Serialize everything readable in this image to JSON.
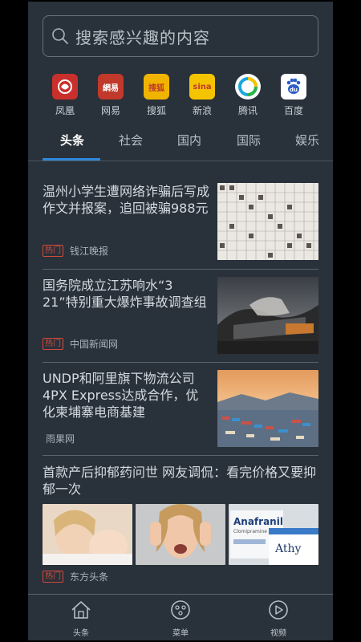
{
  "search": {
    "placeholder": "搜索感兴趣的内容"
  },
  "sources": [
    {
      "name": "凤凰",
      "icon": "ifeng-logo",
      "color": "#c9302c"
    },
    {
      "name": "网易",
      "icon": "netease-logo",
      "color": "#c0392b"
    },
    {
      "name": "搜狐",
      "icon": "sohu-logo",
      "color": "#f0b400"
    },
    {
      "name": "新浪",
      "icon": "sina-logo",
      "color": "#f5c400"
    },
    {
      "name": "腾讯",
      "icon": "tencent-logo",
      "color": "#ffffff"
    },
    {
      "name": "百度",
      "icon": "baidu-logo",
      "color": "#ffffff"
    }
  ],
  "source_logo_text": [
    "",
    "網易",
    "搜狐",
    "sina",
    "",
    "du"
  ],
  "tabs": [
    "头条",
    "社会",
    "国内",
    "国际",
    "娱乐"
  ],
  "active_tab": 0,
  "feed": [
    {
      "title": "温州小学生遭网络诈骗后写成作文并报案，追回被骗988元",
      "hot": "热门",
      "source": "钱江晚报"
    },
    {
      "title": "国务院成立江苏响水“3 21”特别重大爆炸事故调查组",
      "hot": "热门",
      "source": "中国新闻网"
    },
    {
      "title": "UNDP和阿里旗下物流公司4PX Express达成合作，优化柬埔寨电商基建",
      "hot": "",
      "source": "雨果网"
    },
    {
      "title": "首款产后抑郁药问世 网友调侃：看完价格又要抑郁一次",
      "hot": "热门",
      "source": "东方头条"
    }
  ],
  "thumb_text": {
    "drug_box_1": "Anafranil",
    "drug_box_1_sub": "Clomipramine",
    "drug_box_2": "Athy"
  },
  "bottom_nav": [
    {
      "label": "头条",
      "icon": "home-icon"
    },
    {
      "label": "菜单",
      "icon": "menu-icon"
    },
    {
      "label": "视频",
      "icon": "play-icon"
    }
  ],
  "colors": {
    "background": "#29313a",
    "accent": "#2f88d8",
    "hot": "#d44a3a"
  }
}
